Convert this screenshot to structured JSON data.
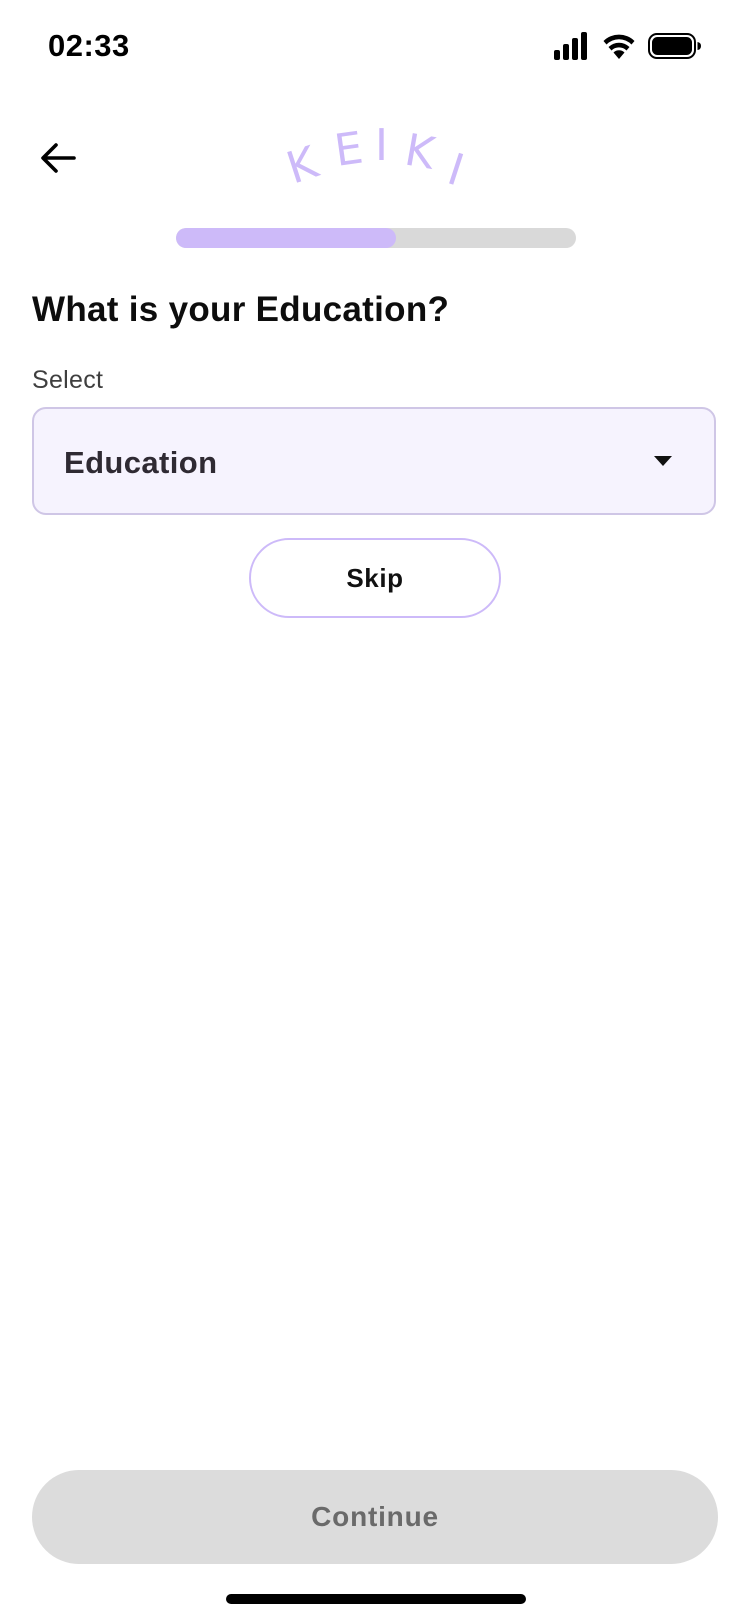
{
  "status_bar": {
    "time": "02:33",
    "icons": [
      "cellular-signal-icon",
      "wifi-icon",
      "battery-icon"
    ]
  },
  "header": {
    "back_icon": "arrow-left-icon",
    "logo_text": "KEIKI",
    "logo_color": "#cdbaf9"
  },
  "progress": {
    "fraction": 0.55,
    "fill_color": "#cdbaf9",
    "track_color": "#d9d9d9"
  },
  "question": {
    "title": "What is your Education?",
    "select_label": "Select",
    "dropdown_value": "Education",
    "dropdown_icon": "caret-down-icon"
  },
  "actions": {
    "skip_label": "Skip",
    "continue_label": "Continue"
  },
  "colors": {
    "accent": "#cdbaf9",
    "field_background": "#f6f3fe",
    "disabled_button": "#dcdcdc"
  }
}
